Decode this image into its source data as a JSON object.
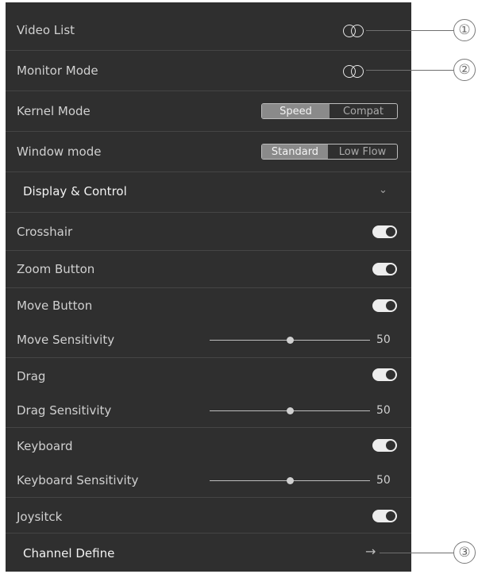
{
  "rows": {
    "video_list": "Video List",
    "monitor_mode": "Monitor Mode",
    "kernel_mode": "Kernel Mode",
    "window_mode": "Window mode",
    "display_control": "Display & Control",
    "crosshair": "Crosshair",
    "zoom_button": "Zoom Button",
    "move_button": "Move Button",
    "move_sensitivity": "Move Sensitivity",
    "drag": "Drag",
    "drag_sensitivity": "Drag Sensitivity",
    "keyboard": "Keyboard",
    "keyboard_sensitivity": "Keyboard Sensitivity",
    "joystick": "Joysitck",
    "channel_define": "Channel Define"
  },
  "kernel_mode": {
    "options": [
      "Speed",
      "Compat"
    ],
    "selected": "Speed"
  },
  "window_mode": {
    "options": [
      "Standard",
      "Low Flow"
    ],
    "selected": "Standard"
  },
  "toggles": {
    "video_list": false,
    "monitor_mode": false,
    "crosshair": true,
    "zoom_button": true,
    "move_button": true,
    "drag": true,
    "keyboard": true,
    "joystick": true
  },
  "sliders": {
    "move_sensitivity": {
      "value": "50"
    },
    "drag_sensitivity": {
      "value": "50"
    },
    "keyboard_sensitivity": {
      "value": "50"
    }
  },
  "icons": {
    "expand": "chevron-down-icon",
    "navigate": "arrow-right-icon"
  },
  "callouts": [
    "①",
    "②",
    "③"
  ],
  "colors": {
    "panel": "#2f2f2f",
    "separator": "#454545",
    "text": "#d0d0d0",
    "accent": "#ededed"
  }
}
